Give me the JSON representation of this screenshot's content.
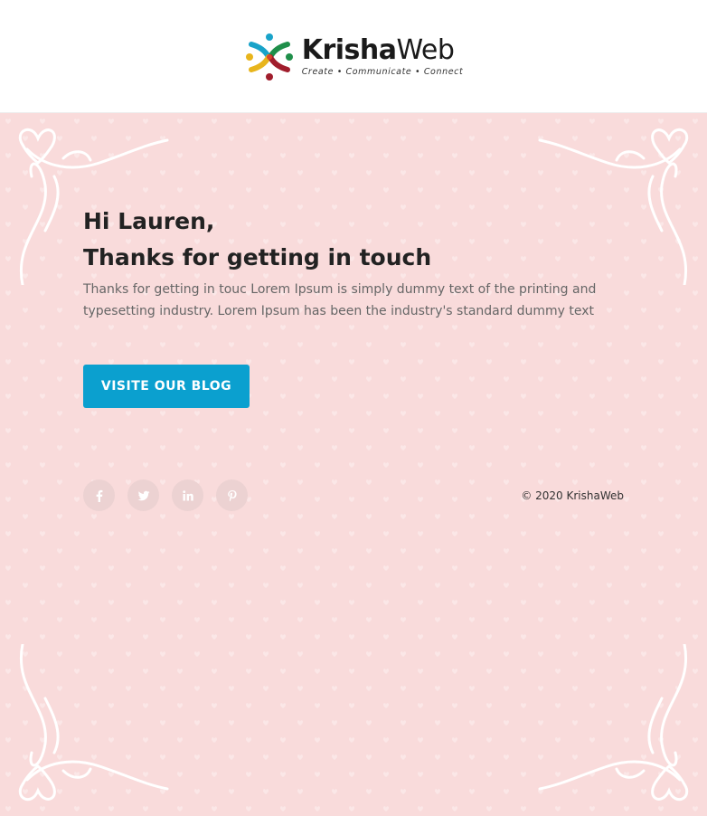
{
  "header": {
    "logo": {
      "word_bold": "Krisha",
      "word_light": "Web",
      "tagline": "Create • Communicate • Connect"
    }
  },
  "content": {
    "greeting_line1": "Hi Lauren,",
    "greeting_line2": "Thanks for getting in touch",
    "body": "Thanks for getting in touc Lorem Ipsum is simply dummy text of the printing and typesetting industry. Lorem Ipsum has been the industry's standard dummy text",
    "cta_label": "VISITE OUR BLOG"
  },
  "footer": {
    "social": [
      {
        "icon": "facebook-icon"
      },
      {
        "icon": "twitter-icon"
      },
      {
        "icon": "linkedin-icon"
      },
      {
        "icon": "pinterest-icon"
      }
    ],
    "copyright": "© 2020 KrishaWeb"
  },
  "colors": {
    "background": "#f9dbdb",
    "accent": "#0ba0cf",
    "social_bg": "#ecd2d2"
  }
}
